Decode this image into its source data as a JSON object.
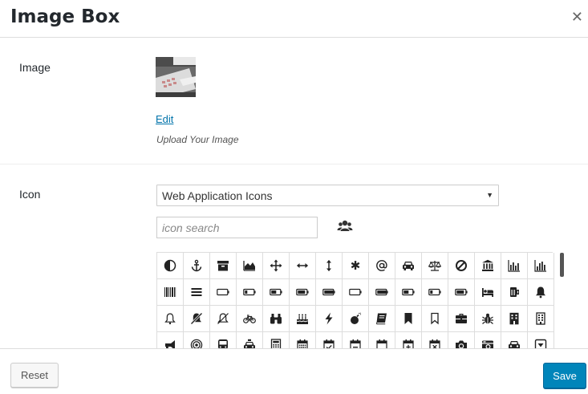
{
  "modal": {
    "title": "Image Box",
    "close_icon": "close-icon"
  },
  "image_field": {
    "label": "Image",
    "edit_link": "Edit",
    "hint": "Upload Your Image"
  },
  "icon_field": {
    "label": "Icon",
    "library_selected": "Web Application Icons",
    "search_placeholder": "icon search",
    "group_icon": "users-icon"
  },
  "icon_grid": {
    "rows": [
      [
        "adjust-icon",
        "anchor-icon",
        "archive-icon",
        "area-chart-icon",
        "arrows-icon",
        "arrows-h-icon",
        "arrows-v-icon",
        "asterisk-icon",
        "at-icon",
        "automobile-icon",
        "balance-scale-icon",
        "ban-icon",
        "bank-icon",
        "bar-chart-icon",
        "bar-chart-o-icon"
      ],
      [
        "barcode-icon",
        "bars-icon",
        "battery-empty-icon",
        "battery-quarter-icon",
        "battery-half-icon",
        "battery-three-quarters-icon",
        "battery-full-icon",
        "battery-empty-icon",
        "battery-full-icon",
        "battery-half-icon",
        "battery-quarter-icon",
        "battery-three-quarters-icon",
        "bed-icon",
        "beer-icon",
        "bell-icon"
      ],
      [
        "bell-o-icon",
        "bell-slash-icon",
        "bell-slash-o-icon",
        "bicycle-icon",
        "binoculars-icon",
        "birthday-cake-icon",
        "bolt-icon",
        "bomb-icon",
        "book-icon",
        "bookmark-icon",
        "bookmark-o-icon",
        "briefcase-icon",
        "bug-icon",
        "building-icon",
        "building-o-icon"
      ],
      [
        "bullhorn-icon",
        "bullseye-icon",
        "bus-icon",
        "cab-icon",
        "calculator-icon",
        "calendar-icon",
        "calendar-check-o-icon",
        "calendar-minus-o-icon",
        "calendar-o-icon",
        "calendar-plus-o-icon",
        "calendar-times-o-icon",
        "camera-icon",
        "camera-retro-icon",
        "car-icon",
        "caret-square-o-down-icon"
      ]
    ]
  },
  "footer": {
    "reset_label": "Reset",
    "save_label": "Save"
  },
  "colors": {
    "primary": "#0085ba",
    "link": "#0073aa",
    "border": "#dddddd"
  }
}
